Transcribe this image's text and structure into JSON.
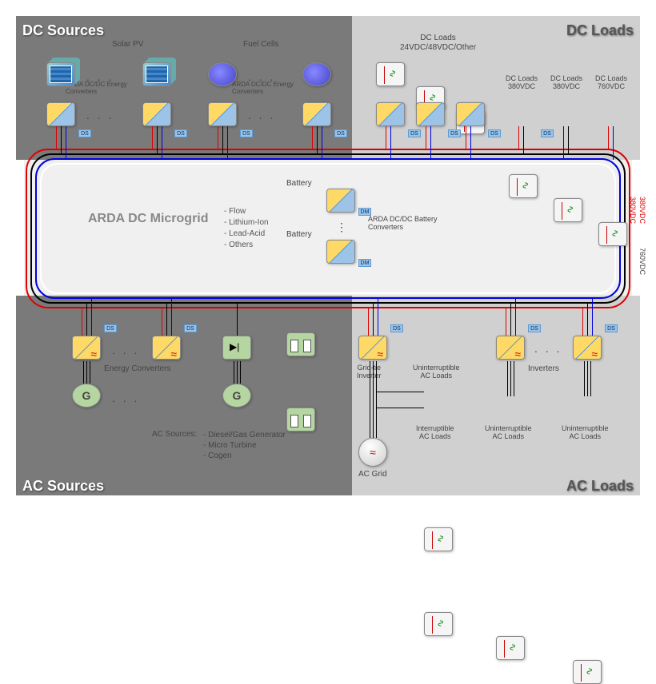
{
  "quadrants": {
    "tl": "DC Sources",
    "tr": "DC Loads",
    "bl": "AC Sources",
    "br": "AC Loads"
  },
  "mgTitle": "ARDA DC Microgrid",
  "batteryTypes": [
    "- Flow",
    "- Lithium-Ion",
    "- Lead-Acid",
    "- Others"
  ],
  "top": {
    "solarPV": "Solar PV",
    "fuelCells": "Fuel Cells",
    "ardaConvLeft": "ARDA DC/DC Energy\nConverters",
    "ardaConvRight": "ARDA DC/DC Energy\nConverters",
    "dcLoadsOther": "DC Loads\n24VDC/48VDC/Other",
    "dcLoads380a": "DC Loads\n380VDC",
    "dcLoads380b": "DC Loads\n380VDC",
    "dcLoads760": "DC Loads\n760VDC"
  },
  "mid": {
    "battery": "Battery",
    "ardaBattConv": "ARDA DC/DC Battery\nConverters",
    "v380": "380VDC",
    "v760": "760VDC"
  },
  "bottom": {
    "energyConv": "Energy Converters",
    "acSources": "AC Sources:",
    "acList": [
      "- Diesel/Gas Generator",
      "- Micro Turbine",
      "- Cogen"
    ],
    "gridTie": "Grid-tie\nInverter",
    "acGrid": "AC Grid",
    "uninterruptible": "Uninterruptible\nAC Loads",
    "interruptible": "Interruptible\nAC Loads",
    "inverters": "Inverters"
  },
  "badge": {
    "ds": "DS",
    "dm": "DM"
  },
  "glyph": {
    "gen": "G",
    "grid": "≈"
  }
}
